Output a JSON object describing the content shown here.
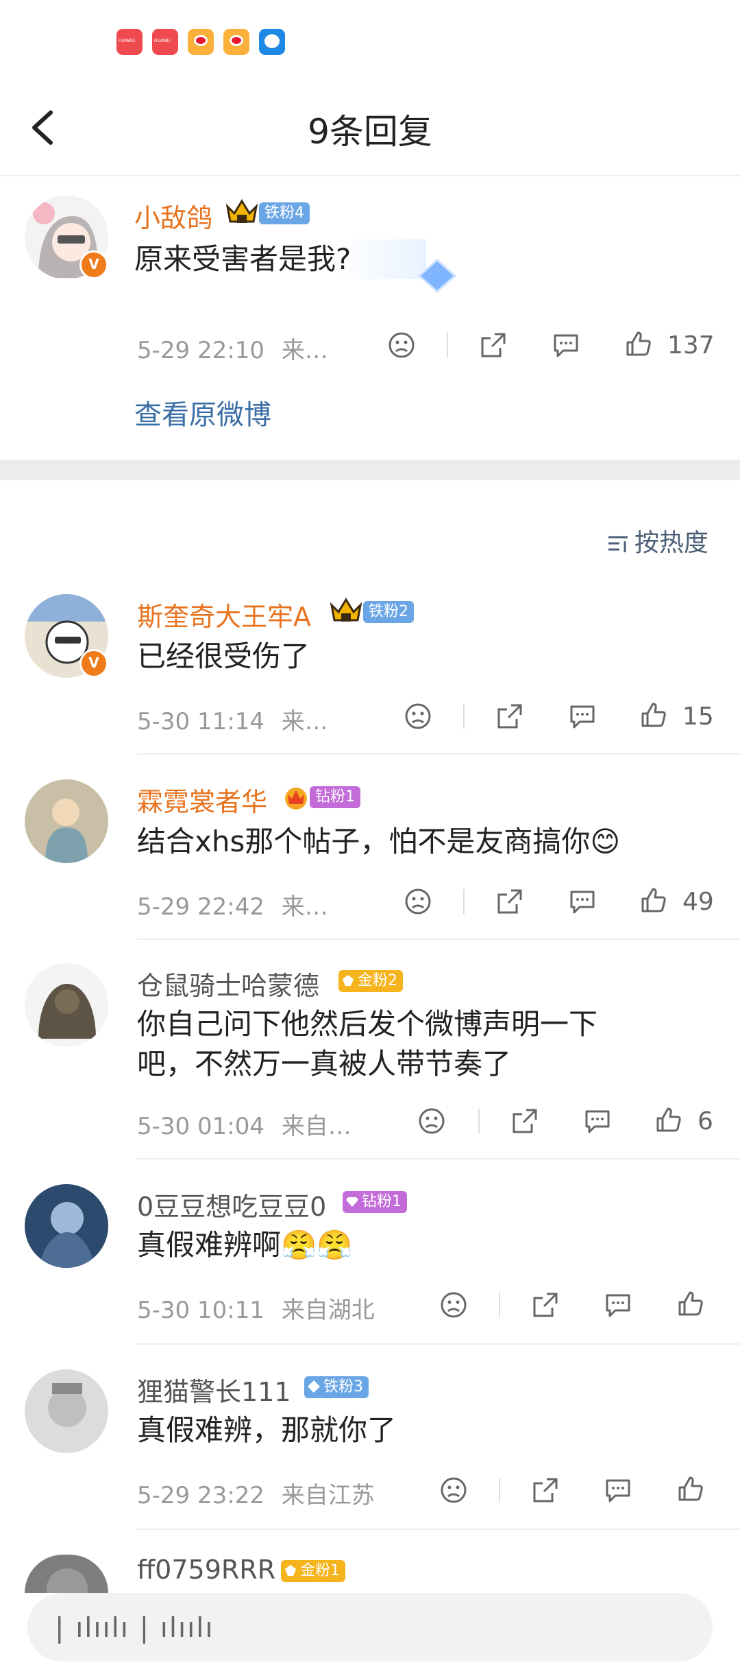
{
  "statusbar": {
    "icons": [
      "huawei-app-icon",
      "huawei-app-icon",
      "weibo-icon",
      "weibo-icon",
      "message-icon"
    ]
  },
  "topbar": {
    "title": "9条回复"
  },
  "main_comment": {
    "username": "小敌鸽",
    "fan_badge": "铁粉4",
    "text": "原来受害者是我?",
    "time": "5-29 22:10",
    "location": "来…",
    "likes": "137",
    "view_original": "查看原微博"
  },
  "sort": {
    "label": "按热度"
  },
  "replies": [
    {
      "username": "斯奎奇大王牢A",
      "fan_badge": "铁粉2",
      "text": "已经很受伤了",
      "time": "5-30 11:14",
      "location": "来…",
      "likes": "15"
    },
    {
      "username": "霖霓裳者华",
      "fan_badge": "钻粉1",
      "text": "结合xhs那个帖子，怕不是友商搞你😊",
      "time": "5-29 22:42",
      "location": "来…",
      "likes": "49"
    },
    {
      "username": "仓鼠骑士哈蒙德",
      "fan_badge": "金粉2",
      "text_line1": "你自己问下他然后发个微博声明一下",
      "text_line2": "吧，不然万一真被人带节奏了",
      "time": "5-30 01:04",
      "location": "来自…",
      "likes": "6"
    },
    {
      "username": "0豆豆想吃豆豆0",
      "fan_badge": "钻粉1",
      "text": "真假难辨啊😤😤",
      "time": "5-30 10:11",
      "location": "来自湖北",
      "likes": ""
    },
    {
      "username": "狸猫警长111",
      "fan_badge": "铁粉3",
      "text": "真假难辨，那就你了",
      "time": "5-29 23:22",
      "location": "来自江苏",
      "likes": ""
    },
    {
      "username": "ff0759RRR",
      "fan_badge": "金粉1"
    }
  ],
  "input": {
    "placeholder": "| ılıılı | ılıılı"
  },
  "colors": {
    "vip_name": "#e8731f",
    "link": "#3a6ea5",
    "iron_badge": "#6aa6e6",
    "diamond_badge": "#c26bd9",
    "gold_badge": "#f5b31c"
  }
}
